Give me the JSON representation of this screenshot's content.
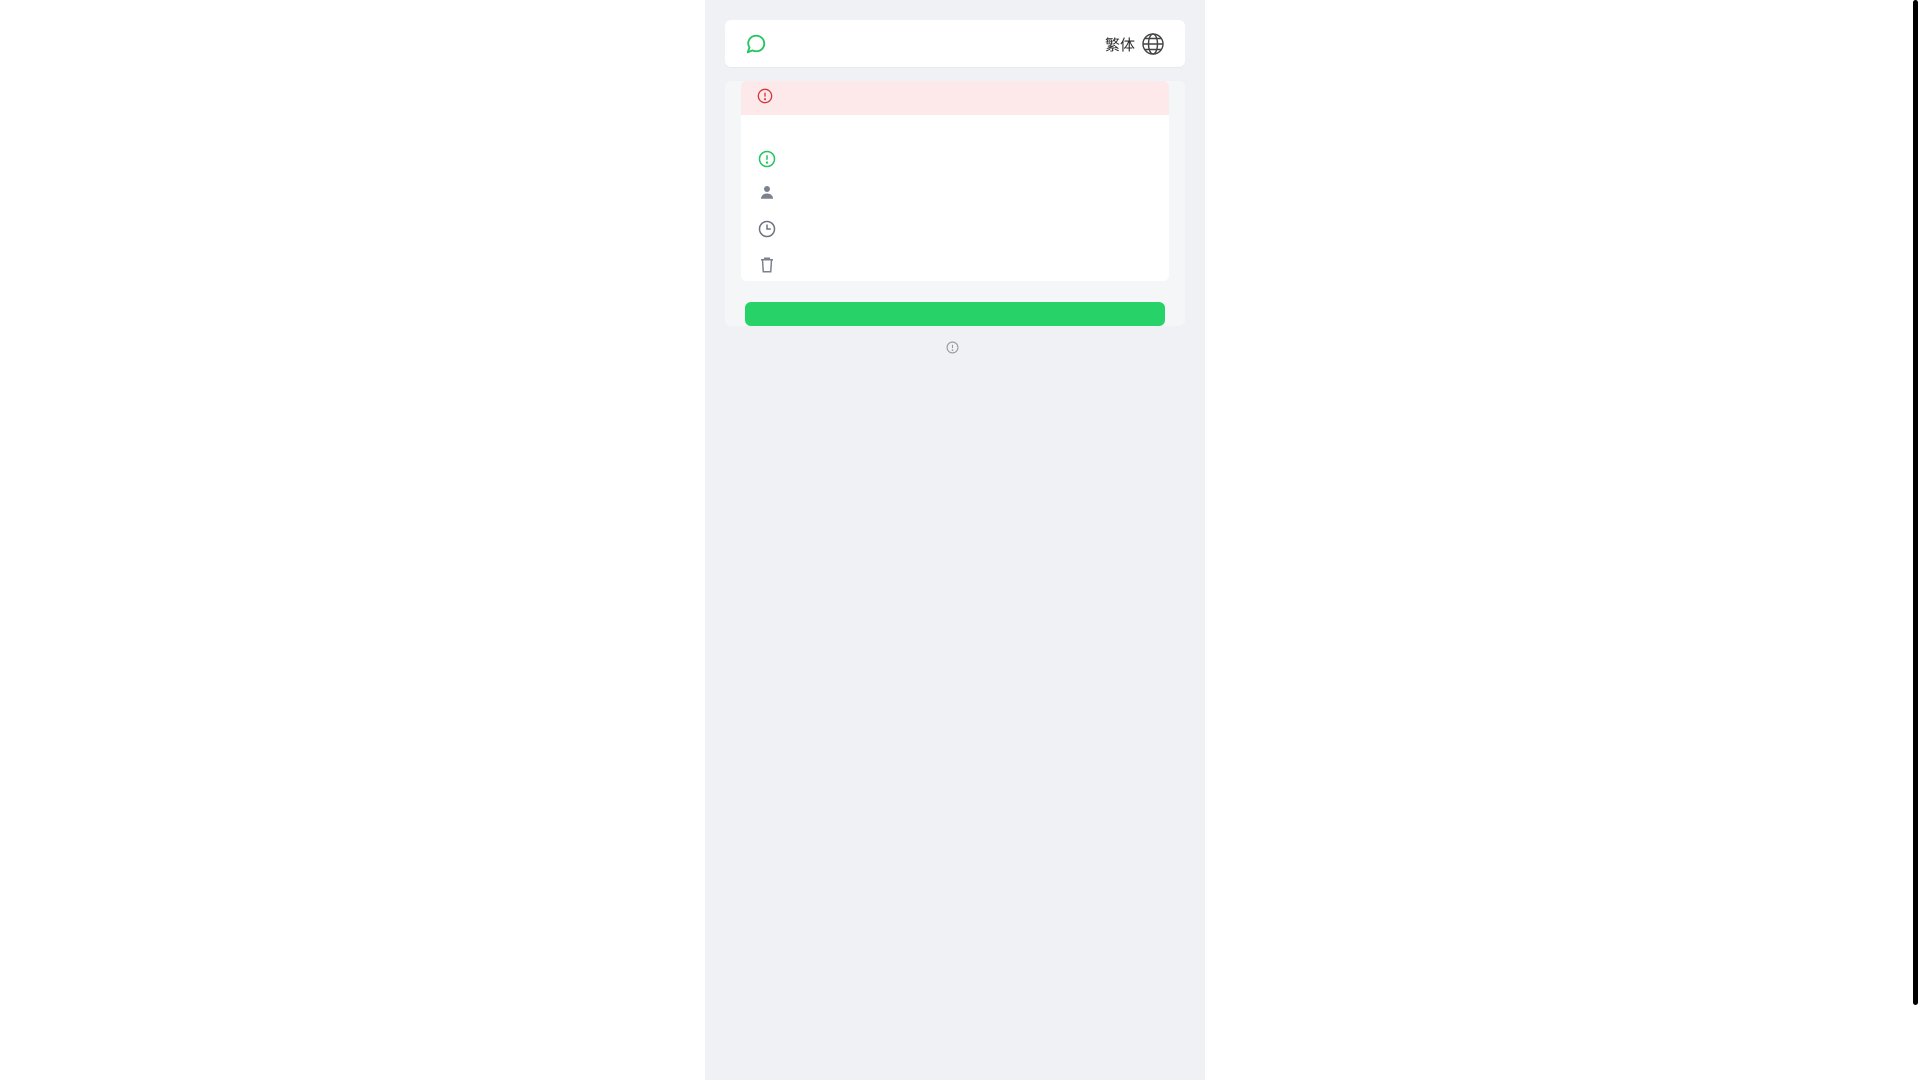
{
  "header": {
    "logo_icon": "chat-bubble-icon",
    "language_label": "繁体",
    "language_icon": "globe-icon"
  },
  "alert": {
    "icon": "alert-circle-icon",
    "text": ""
  },
  "details": {
    "status": {
      "icon": "exclamation-circle-icon",
      "text": ""
    },
    "user": {
      "icon": "user-icon",
      "text": ""
    },
    "time": {
      "icon": "clock-icon",
      "text": ""
    },
    "delete": {
      "icon": "trash-icon",
      "text": ""
    }
  },
  "actions": {
    "primary_label": ""
  },
  "footnote": {
    "icon": "info-circle-icon",
    "text": ""
  },
  "colors": {
    "brand_green": "#27d368",
    "alert_red": "#d8363c",
    "alert_bg": "#fde8ea",
    "panel_bg": "#f0f1f4"
  }
}
